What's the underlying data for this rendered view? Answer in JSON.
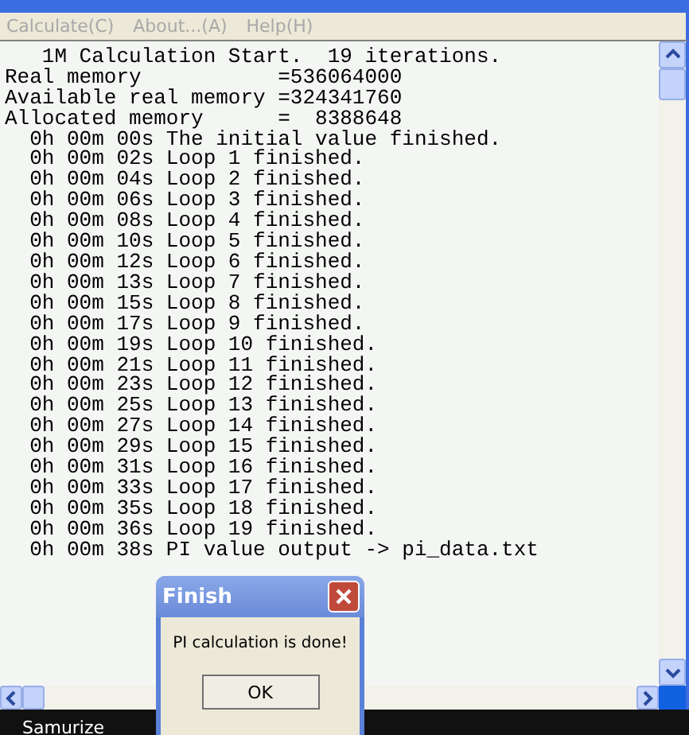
{
  "menu": [
    "Calculate(C)",
    "About...(A)",
    "Help(H)"
  ],
  "output_lines": [
    "   1M Calculation Start.  19 iterations.",
    "Real memory           =536064000",
    "Available real memory =324341760",
    "Allocated memory      =  8388648",
    "  0h 00m 00s The initial value finished.",
    "  0h 00m 02s Loop 1 finished.",
    "  0h 00m 04s Loop 2 finished.",
    "  0h 00m 06s Loop 3 finished.",
    "  0h 00m 08s Loop 4 finished.",
    "  0h 00m 10s Loop 5 finished.",
    "  0h 00m 12s Loop 6 finished.",
    "  0h 00m 13s Loop 7 finished.",
    "  0h 00m 15s Loop 8 finished.",
    "  0h 00m 17s Loop 9 finished.",
    "  0h 00m 19s Loop 10 finished.",
    "  0h 00m 21s Loop 11 finished.",
    "  0h 00m 23s Loop 12 finished.",
    "  0h 00m 25s Loop 13 finished.",
    "  0h 00m 27s Loop 14 finished.",
    "  0h 00m 29s Loop 15 finished.",
    "  0h 00m 31s Loop 16 finished.",
    "  0h 00m 33s Loop 17 finished.",
    "  0h 00m 35s Loop 18 finished.",
    "  0h 00m 36s Loop 19 finished.",
    "  0h 00m 38s PI value output -> pi_data.txt"
  ],
  "dialog": {
    "title": "Finish",
    "message": "PI calculation is done!",
    "button": "OK"
  },
  "taskbar": {
    "item": "Samurize"
  }
}
